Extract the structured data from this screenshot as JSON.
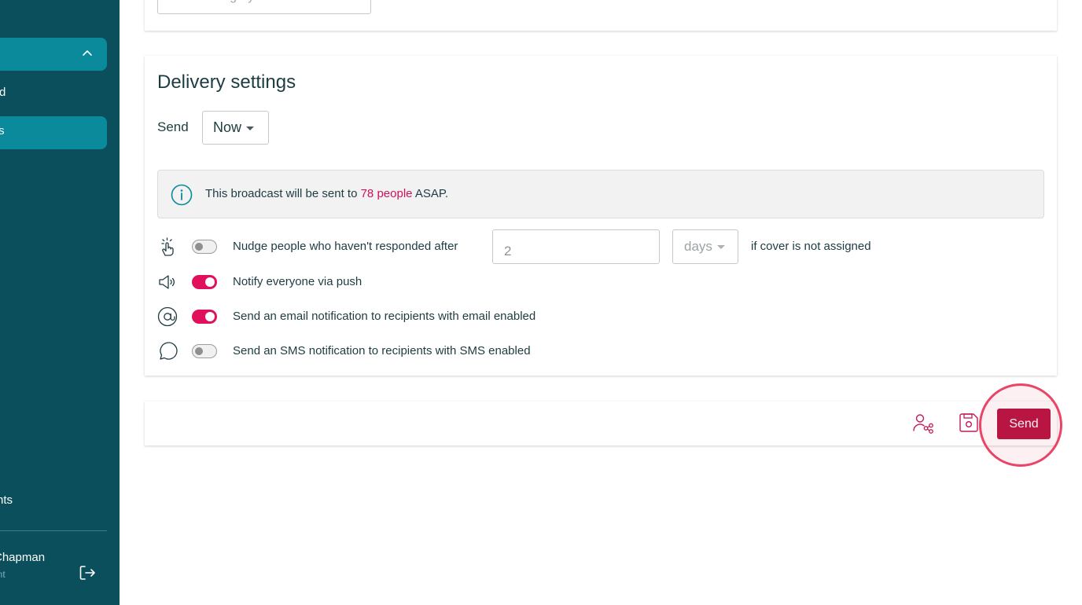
{
  "sidebar": {
    "item_clipped_1": "d",
    "item_clipped_2": "ts",
    "item_clipped_3": "nts",
    "user_name": "Chapman",
    "user_sub": "unt"
  },
  "top_card": {
    "category_placeholder": "Select category"
  },
  "delivery": {
    "title": "Delivery settings",
    "send_label": "Send",
    "send_value": "Now",
    "info": {
      "prefix": "This broadcast will be sent to ",
      "highlight": "78 people",
      "suffix": " ASAP."
    },
    "nudge": {
      "label": "Nudge people who haven't responded after",
      "value": "2",
      "unit": "days",
      "suffix": "if cover is not assigned",
      "enabled": false
    },
    "push": {
      "label": "Notify everyone via push",
      "enabled": true
    },
    "email": {
      "label": "Send an email notification to recipients with email enabled",
      "enabled": true
    },
    "sms": {
      "label": "Send an SMS notification to recipients with SMS enabled",
      "enabled": false
    }
  },
  "actions": {
    "send_label": "Send"
  },
  "colors": {
    "sidebar_bg": "#0a4f5b",
    "sidebar_active": "#0b8a9c",
    "accent_pink": "#e0105c",
    "send_button": "#b5123f",
    "highlight_ring": "#ea4466"
  }
}
